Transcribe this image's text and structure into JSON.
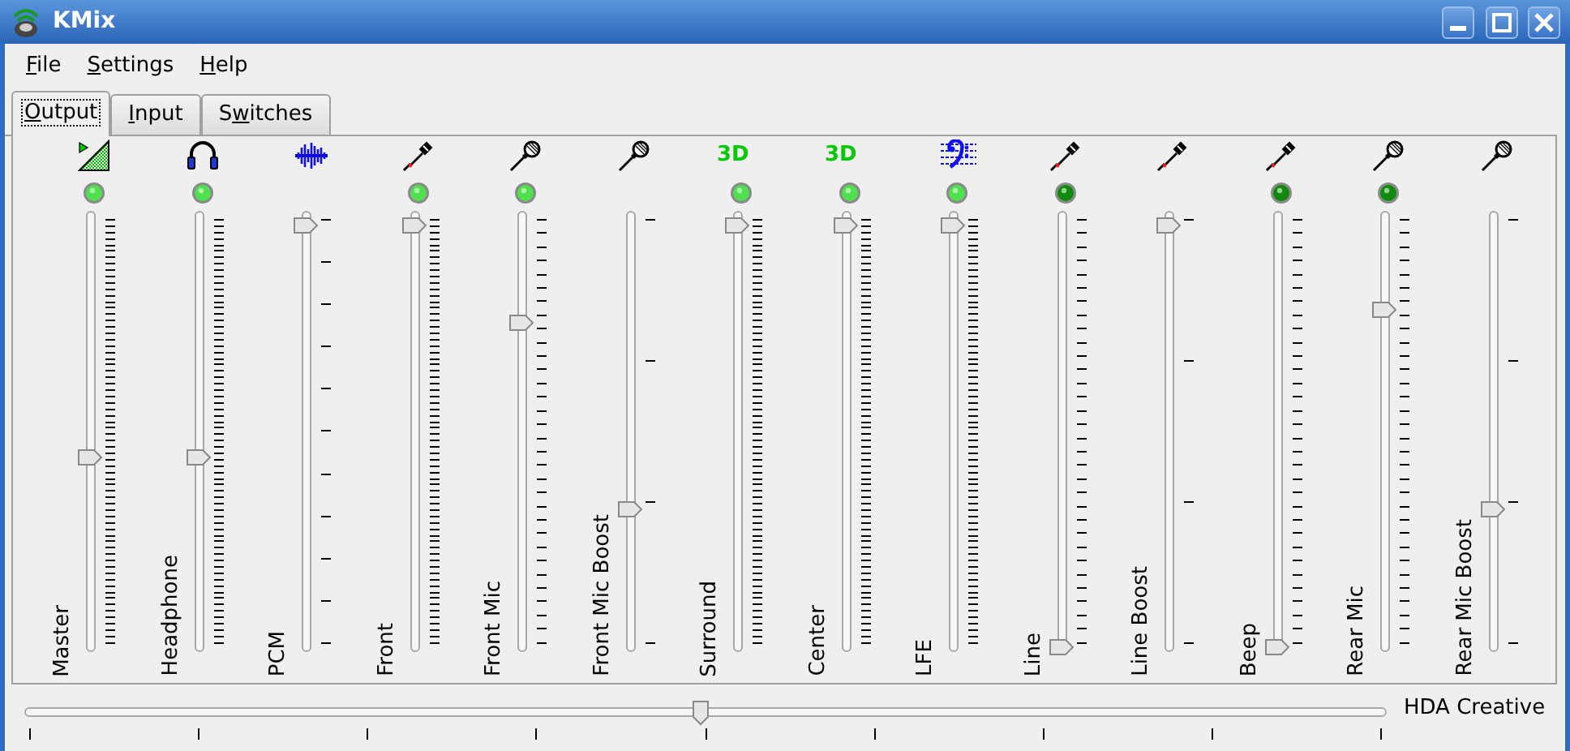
{
  "window": {
    "title": "KMix"
  },
  "menu": [
    {
      "mnemonic": "F",
      "rest": "ile"
    },
    {
      "mnemonic": "S",
      "rest": "ettings"
    },
    {
      "mnemonic": "H",
      "rest": "elp"
    }
  ],
  "tabs": [
    {
      "mnemonic": "O",
      "rest": "utput",
      "selected": true
    },
    {
      "mnemonic": "I",
      "rest": "nput",
      "selected": false
    },
    {
      "before": "S",
      "mnemonic": "w",
      "rest": "itches",
      "selected": false
    }
  ],
  "channels": [
    {
      "name": "Master",
      "kind": "volume",
      "color": "#4fe04f",
      "level": 0.45
    },
    {
      "name": "Headphone",
      "kind": "headphones",
      "color": "#4fe04f",
      "level": 0.45
    },
    {
      "name": "PCM",
      "kind": "wave",
      "level": 1
    },
    {
      "name": "Front",
      "kind": "plug",
      "color": "#4fe04f",
      "level": 1
    },
    {
      "name": "Front Mic",
      "kind": "mic",
      "color": "#4fe04f",
      "level": 0.77
    },
    {
      "name": "Front Mic Boost",
      "kind": "mic",
      "level": 0.33
    },
    {
      "name": "Surround",
      "kind": "text",
      "icon_text": "3D",
      "color": "#4fe04f",
      "level": 1
    },
    {
      "name": "Center",
      "kind": "text",
      "icon_text": "3D",
      "color": "#4fe04f",
      "level": 1
    },
    {
      "name": "LFE",
      "kind": "clef",
      "color": "#4fe04f",
      "level": 1
    },
    {
      "name": "Line",
      "kind": "plug",
      "color": "#0f8a0f",
      "level": 0
    },
    {
      "name": "Line Boost",
      "kind": "plug",
      "level": 1
    },
    {
      "name": "Beep",
      "kind": "plug",
      "color": "#0f8a0f",
      "level": 0
    },
    {
      "name": "Rear Mic",
      "kind": "mic",
      "color": "#0f8a0f",
      "level": 0.8
    },
    {
      "name": "Rear Mic Boost",
      "kind": "mic",
      "level": 0.33
    }
  ],
  "balance": {
    "level": 0.5,
    "label": "HDA Creative"
  }
}
